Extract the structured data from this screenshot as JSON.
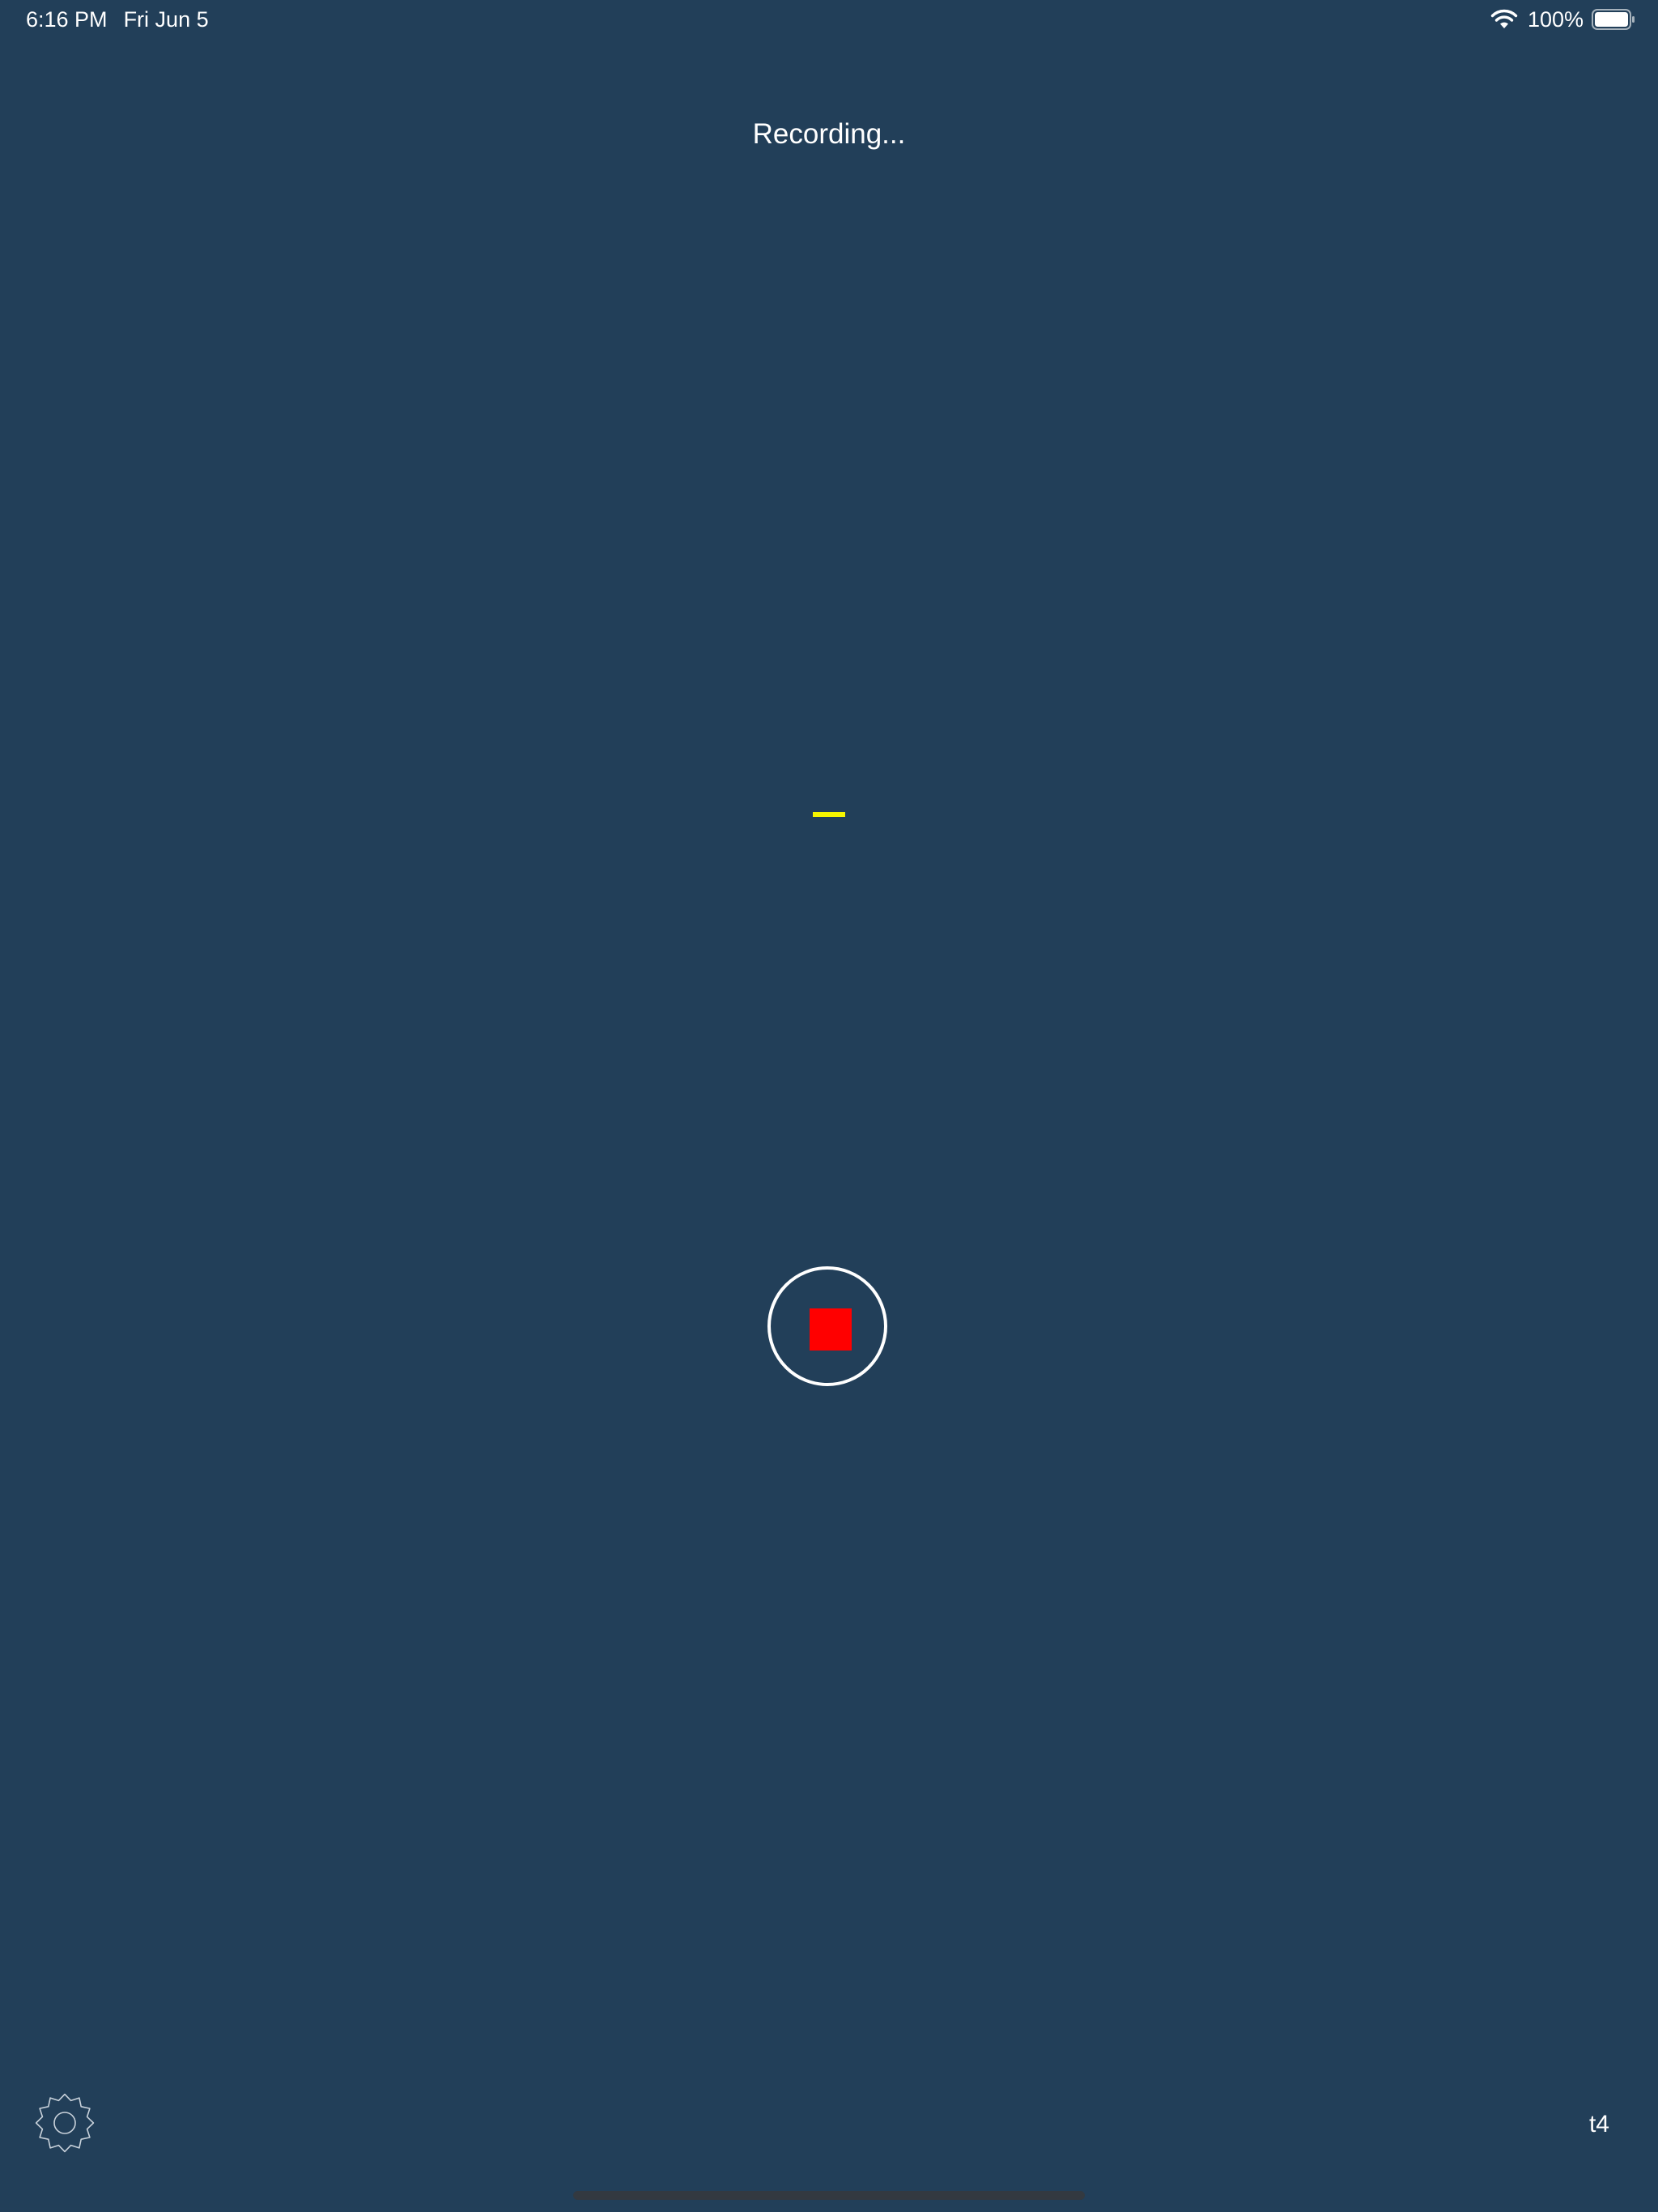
{
  "status_bar": {
    "time": "6:16 PM",
    "date": "Fri Jun 5",
    "battery_percent": "100%",
    "wifi_icon": "wifi-icon",
    "battery_icon": "battery-full-icon",
    "battery_level": 1.0
  },
  "recorder": {
    "status_text": "Recording...",
    "level_indicator_color": "#f5f500",
    "stop_button_icon": "stop-square-icon",
    "stop_color": "#ff0000"
  },
  "footer": {
    "settings_icon": "gear-icon",
    "label": "t4"
  },
  "theme": {
    "background": "#223f59",
    "foreground": "#ffffff"
  }
}
